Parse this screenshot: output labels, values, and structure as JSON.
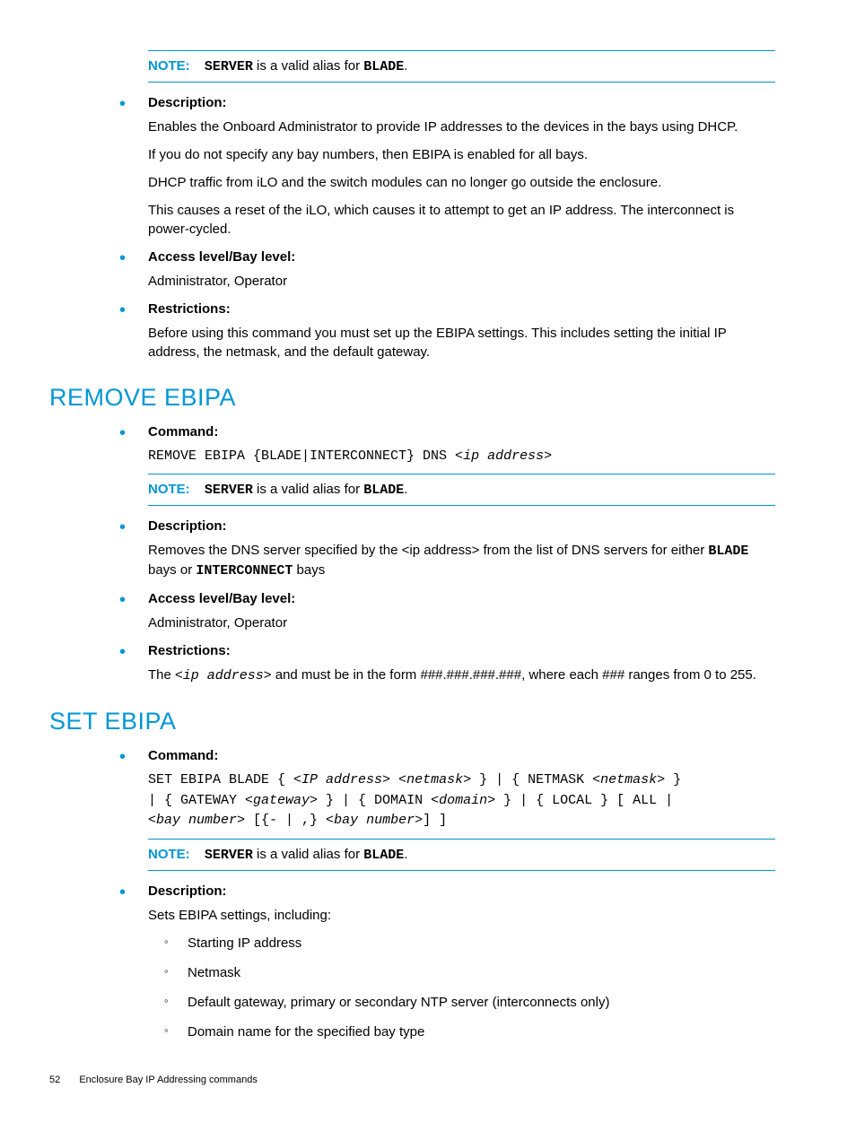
{
  "note_label": "NOTE:",
  "note_text_prefix": " is a valid alias for ",
  "note_server": "SERVER",
  "note_blade": "BLADE",
  "note_period": ".",
  "section1": {
    "desc_label": "Description:",
    "desc_p1": "Enables the Onboard Administrator to provide IP addresses to the devices in the bays using DHCP.",
    "desc_p2": "If you do not specify any bay numbers, then EBIPA is enabled for all bays.",
    "desc_p3": "DHCP traffic from iLO and the switch modules can no longer go outside the enclosure.",
    "desc_p4": "This causes a reset of the iLO, which causes it to attempt to get an IP address. The interconnect is power-cycled.",
    "access_label": "Access level/Bay level:",
    "access_text": "Administrator, Operator",
    "restrict_label": "Restrictions:",
    "restrict_text": "Before using this command you must set up the EBIPA settings. This includes setting the initial IP address, the netmask, and the default gateway."
  },
  "remove_ebipa": {
    "title": "REMOVE EBIPA",
    "cmd_label": "Command:",
    "cmd_plain": "REMOVE EBIPA {BLADE|INTERCONNECT} DNS <",
    "cmd_italic": "ip address",
    "cmd_end": ">",
    "desc_label": "Description:",
    "desc_p1a": "Removes the DNS server specified by the <ip address> from the list of DNS servers for either ",
    "desc_blade": "BLADE",
    "desc_mid": " bays or ",
    "desc_inter": "INTERCONNECT",
    "desc_end": " bays",
    "access_label": "Access level/Bay level:",
    "access_text": "Administrator, Operator",
    "restrict_label": "Restrictions:",
    "restrict_pre": "The <",
    "restrict_ip": "ip address",
    "restrict_post": "> and must be in the form ###.###.###.###, where each ### ranges from 0 to 255."
  },
  "set_ebipa": {
    "title": "SET EBIPA",
    "cmd_label": "Command:",
    "cmd_l1a": "SET EBIPA BLADE { <",
    "cmd_l1_ip": "IP address",
    "cmd_l1b": "> <",
    "cmd_l1_nm": "netmask",
    "cmd_l1c": "> } | { NETMASK <",
    "cmd_l1_nm2": "netmask",
    "cmd_l1d": "> }",
    "cmd_l2a": "| { GATEWAY <",
    "cmd_l2_gw": "gateway",
    "cmd_l2b": "> } | { DOMAIN <",
    "cmd_l2_dm": "domain",
    "cmd_l2c": "> } | { LOCAL } [ ALL |",
    "cmd_l3a": "<",
    "cmd_l3_bn": "bay number",
    "cmd_l3b": "> [{- | ,} <",
    "cmd_l3_bn2": "bay number",
    "cmd_l3c": ">] ]",
    "desc_label": "Description:",
    "desc_text": "Sets EBIPA settings, including:",
    "sub1": "Starting IP address",
    "sub2": "Netmask",
    "sub3": "Default gateway, primary or secondary NTP server (interconnects only)",
    "sub4": "Domain name for the specified bay type"
  },
  "footer": {
    "page": "52",
    "title": "Enclosure Bay IP Addressing commands"
  }
}
